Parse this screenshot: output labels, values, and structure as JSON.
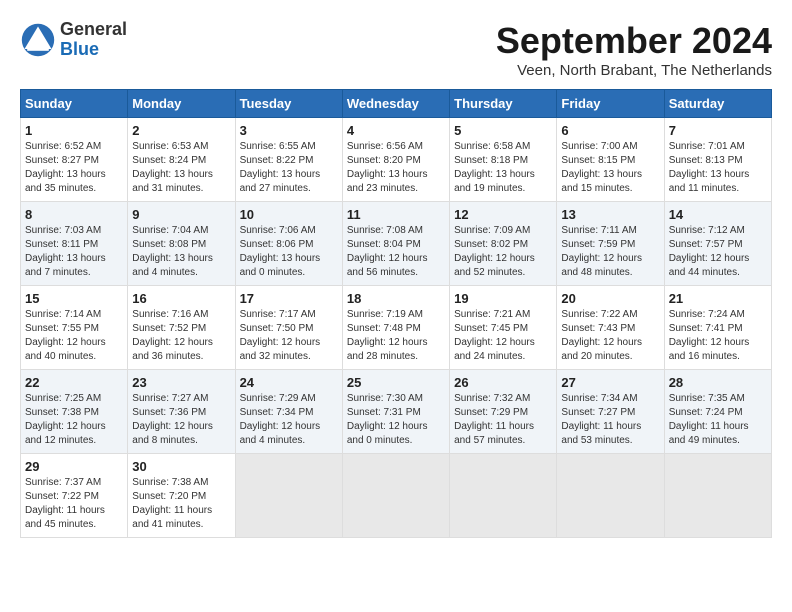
{
  "header": {
    "logo_general": "General",
    "logo_blue": "Blue",
    "month_year": "September 2024",
    "location": "Veen, North Brabant, The Netherlands"
  },
  "weekdays": [
    "Sunday",
    "Monday",
    "Tuesday",
    "Wednesday",
    "Thursday",
    "Friday",
    "Saturday"
  ],
  "weeks": [
    [
      {
        "day": "1",
        "info": "Sunrise: 6:52 AM\nSunset: 8:27 PM\nDaylight: 13 hours\nand 35 minutes."
      },
      {
        "day": "2",
        "info": "Sunrise: 6:53 AM\nSunset: 8:24 PM\nDaylight: 13 hours\nand 31 minutes."
      },
      {
        "day": "3",
        "info": "Sunrise: 6:55 AM\nSunset: 8:22 PM\nDaylight: 13 hours\nand 27 minutes."
      },
      {
        "day": "4",
        "info": "Sunrise: 6:56 AM\nSunset: 8:20 PM\nDaylight: 13 hours\nand 23 minutes."
      },
      {
        "day": "5",
        "info": "Sunrise: 6:58 AM\nSunset: 8:18 PM\nDaylight: 13 hours\nand 19 minutes."
      },
      {
        "day": "6",
        "info": "Sunrise: 7:00 AM\nSunset: 8:15 PM\nDaylight: 13 hours\nand 15 minutes."
      },
      {
        "day": "7",
        "info": "Sunrise: 7:01 AM\nSunset: 8:13 PM\nDaylight: 13 hours\nand 11 minutes."
      }
    ],
    [
      {
        "day": "8",
        "info": "Sunrise: 7:03 AM\nSunset: 8:11 PM\nDaylight: 13 hours\nand 7 minutes."
      },
      {
        "day": "9",
        "info": "Sunrise: 7:04 AM\nSunset: 8:08 PM\nDaylight: 13 hours\nand 4 minutes."
      },
      {
        "day": "10",
        "info": "Sunrise: 7:06 AM\nSunset: 8:06 PM\nDaylight: 13 hours\nand 0 minutes."
      },
      {
        "day": "11",
        "info": "Sunrise: 7:08 AM\nSunset: 8:04 PM\nDaylight: 12 hours\nand 56 minutes."
      },
      {
        "day": "12",
        "info": "Sunrise: 7:09 AM\nSunset: 8:02 PM\nDaylight: 12 hours\nand 52 minutes."
      },
      {
        "day": "13",
        "info": "Sunrise: 7:11 AM\nSunset: 7:59 PM\nDaylight: 12 hours\nand 48 minutes."
      },
      {
        "day": "14",
        "info": "Sunrise: 7:12 AM\nSunset: 7:57 PM\nDaylight: 12 hours\nand 44 minutes."
      }
    ],
    [
      {
        "day": "15",
        "info": "Sunrise: 7:14 AM\nSunset: 7:55 PM\nDaylight: 12 hours\nand 40 minutes."
      },
      {
        "day": "16",
        "info": "Sunrise: 7:16 AM\nSunset: 7:52 PM\nDaylight: 12 hours\nand 36 minutes."
      },
      {
        "day": "17",
        "info": "Sunrise: 7:17 AM\nSunset: 7:50 PM\nDaylight: 12 hours\nand 32 minutes."
      },
      {
        "day": "18",
        "info": "Sunrise: 7:19 AM\nSunset: 7:48 PM\nDaylight: 12 hours\nand 28 minutes."
      },
      {
        "day": "19",
        "info": "Sunrise: 7:21 AM\nSunset: 7:45 PM\nDaylight: 12 hours\nand 24 minutes."
      },
      {
        "day": "20",
        "info": "Sunrise: 7:22 AM\nSunset: 7:43 PM\nDaylight: 12 hours\nand 20 minutes."
      },
      {
        "day": "21",
        "info": "Sunrise: 7:24 AM\nSunset: 7:41 PM\nDaylight: 12 hours\nand 16 minutes."
      }
    ],
    [
      {
        "day": "22",
        "info": "Sunrise: 7:25 AM\nSunset: 7:38 PM\nDaylight: 12 hours\nand 12 minutes."
      },
      {
        "day": "23",
        "info": "Sunrise: 7:27 AM\nSunset: 7:36 PM\nDaylight: 12 hours\nand 8 minutes."
      },
      {
        "day": "24",
        "info": "Sunrise: 7:29 AM\nSunset: 7:34 PM\nDaylight: 12 hours\nand 4 minutes."
      },
      {
        "day": "25",
        "info": "Sunrise: 7:30 AM\nSunset: 7:31 PM\nDaylight: 12 hours\nand 0 minutes."
      },
      {
        "day": "26",
        "info": "Sunrise: 7:32 AM\nSunset: 7:29 PM\nDaylight: 11 hours\nand 57 minutes."
      },
      {
        "day": "27",
        "info": "Sunrise: 7:34 AM\nSunset: 7:27 PM\nDaylight: 11 hours\nand 53 minutes."
      },
      {
        "day": "28",
        "info": "Sunrise: 7:35 AM\nSunset: 7:24 PM\nDaylight: 11 hours\nand 49 minutes."
      }
    ],
    [
      {
        "day": "29",
        "info": "Sunrise: 7:37 AM\nSunset: 7:22 PM\nDaylight: 11 hours\nand 45 minutes."
      },
      {
        "day": "30",
        "info": "Sunrise: 7:38 AM\nSunset: 7:20 PM\nDaylight: 11 hours\nand 41 minutes."
      },
      {
        "day": "",
        "info": ""
      },
      {
        "day": "",
        "info": ""
      },
      {
        "day": "",
        "info": ""
      },
      {
        "day": "",
        "info": ""
      },
      {
        "day": "",
        "info": ""
      }
    ]
  ]
}
